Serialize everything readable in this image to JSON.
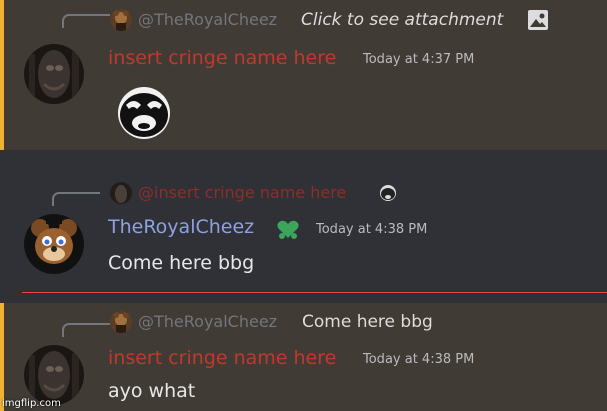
{
  "messages": [
    {
      "reply": {
        "author": "@TheRoyalCheez",
        "text": "Click to see attachment"
      },
      "author": "insert cringe name here",
      "timestamp": "Today at 4:37 PM"
    },
    {
      "reply": {
        "author": "@insert cringe name here"
      },
      "author": "TheRoyalCheez",
      "timestamp": "Today at 4:38 PM",
      "content": "Come here bbg"
    },
    {
      "reply": {
        "author": "@TheRoyalCheez",
        "text": "Come here bbg"
      },
      "author": "insert cringe name here",
      "timestamp": "Today at 4:38 PM",
      "content": "ayo what"
    }
  ],
  "watermark": "imgflip.com",
  "colors": {
    "accent_mention": "#f0b232",
    "username_red": "#c0392b",
    "username_blue": "#8ea1e1",
    "new_divider": "#ed4245"
  }
}
